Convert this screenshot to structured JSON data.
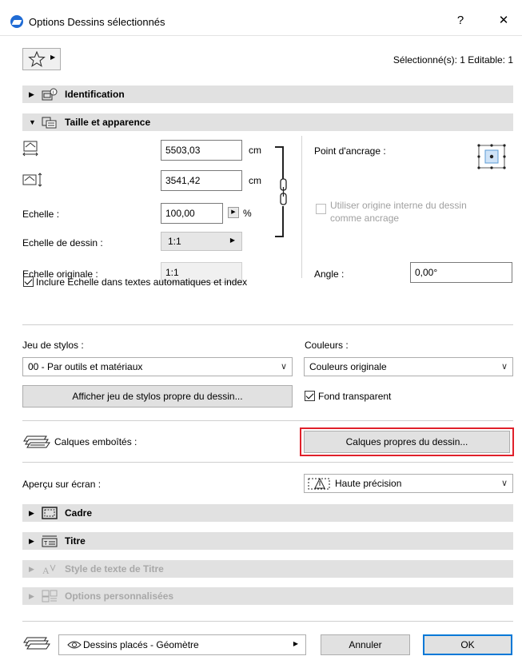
{
  "window": {
    "title": "Options Dessins sélectionnés",
    "help_label": "?",
    "close_label": "✕"
  },
  "toolbar": {
    "favorites_icon": "star-icon",
    "status": "Sélectionné(s): 1 Editable: 1"
  },
  "sections": {
    "identification": "Identification",
    "size": "Taille et apparence",
    "frame": "Cadre",
    "title": "Titre",
    "title_style": "Style de texte de Titre",
    "custom": "Options personnalisées"
  },
  "size": {
    "width_value": "5503,03",
    "width_unit": "cm",
    "height_value": "3541,42",
    "height_unit": "cm",
    "scale_label": "Echelle :",
    "scale_value": "100,00",
    "scale_unit": "%",
    "drawing_scale_label": "Echelle de dessin :",
    "drawing_scale_value": "1:1",
    "original_scale_label": "Echelle originale :",
    "original_scale_value": "1:1",
    "anchor_label": "Point d'ancrage :",
    "use_origin_label_line1": "Utiliser origine interne du dessin",
    "use_origin_label_line2": "comme ancrage",
    "angle_label": "Angle :",
    "angle_value": "0,00°",
    "include_scale_label": "Inclure Echelle dans textes automatiques et index"
  },
  "pens": {
    "penset_label": "Jeu de stylos :",
    "penset_value": "00 - Par outils et matériaux",
    "colors_label": "Couleurs :",
    "colors_value": "Couleurs originale",
    "show_penset_button": "Afficher jeu de stylos propre du dessin...",
    "transparent_label": "Fond transparent"
  },
  "layers": {
    "nested_label": "Calques emboîtés :",
    "own_layers_button": "Calques propres du dessin..."
  },
  "preview": {
    "label": "Aperçu sur écran :",
    "value": "Haute précision"
  },
  "footer": {
    "layer_combo_value": "Dessins placés - Géomètre",
    "cancel": "Annuler",
    "ok": "OK"
  },
  "colors": {
    "section_bar": "#e1e1e1",
    "highlight_border": "#e0202a",
    "ok_border": "#0078d7",
    "anchor_selected": "#cfe3f7"
  }
}
